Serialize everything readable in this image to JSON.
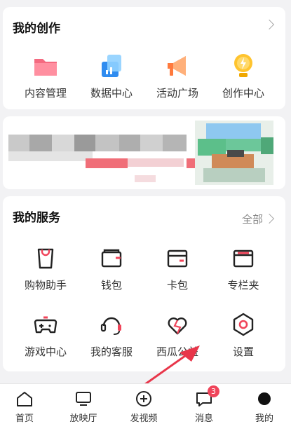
{
  "creation": {
    "title": "我的创作",
    "items": [
      {
        "label": "内容管理",
        "icon": "folder-icon"
      },
      {
        "label": "数据中心",
        "icon": "data-center-icon"
      },
      {
        "label": "活动广场",
        "icon": "megaphone-icon"
      },
      {
        "label": "创作中心",
        "icon": "lightbulb-icon"
      }
    ]
  },
  "services": {
    "title": "我的服务",
    "all_label": "全部",
    "items": [
      {
        "label": "购物助手",
        "icon": "shopping-bag-icon"
      },
      {
        "label": "钱包",
        "icon": "wallet-icon"
      },
      {
        "label": "卡包",
        "icon": "card-holder-icon"
      },
      {
        "label": "专栏夹",
        "icon": "column-folder-icon"
      },
      {
        "label": "游戏中心",
        "icon": "gamepad-icon"
      },
      {
        "label": "我的客服",
        "icon": "headset-icon"
      },
      {
        "label": "西瓜公益",
        "icon": "heart-icon"
      },
      {
        "label": "设置",
        "icon": "settings-icon"
      }
    ]
  },
  "bottom_nav": {
    "items": [
      {
        "label": "首页",
        "icon": "home-icon"
      },
      {
        "label": "放映厅",
        "icon": "tv-icon"
      },
      {
        "label": "发视频",
        "icon": "plus-circle-icon"
      },
      {
        "label": "消息",
        "icon": "message-icon",
        "badge": "3"
      },
      {
        "label": "我的",
        "icon": "profile-icon"
      }
    ]
  },
  "colors": {
    "accent": "#f0445a",
    "background": "#f2f2f4",
    "card": "#ffffff",
    "arrow": "#e8364a"
  }
}
